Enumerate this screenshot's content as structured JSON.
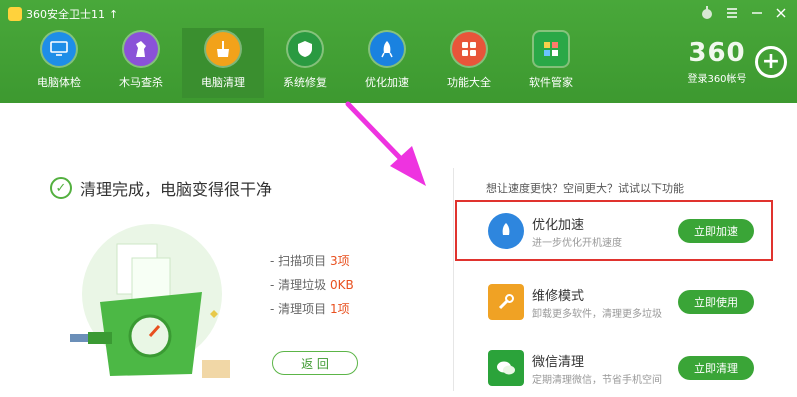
{
  "app_title": "360安全卫士11",
  "app_title_arrow": "↑",
  "window_controls": [
    "skin-icon",
    "menu-icon",
    "minimize-icon",
    "close-icon"
  ],
  "tools": [
    {
      "label": "电脑体检",
      "icon": "monitor-icon",
      "color": "#1e8ee8"
    },
    {
      "label": "木马查杀",
      "icon": "horse-icon",
      "color": "#8a52d8"
    },
    {
      "label": "电脑清理",
      "icon": "broom-icon",
      "color": "#f2a21a",
      "active": true
    },
    {
      "label": "系统修复",
      "icon": "shield-icon",
      "color": "#2a9a41"
    },
    {
      "label": "优化加速",
      "icon": "rocket-icon",
      "color": "#1a82e0"
    },
    {
      "label": "功能大全",
      "icon": "grid-icon",
      "color": "#e8553a"
    },
    {
      "label": "软件管家",
      "icon": "apps-icon",
      "color": "#2aa847"
    }
  ],
  "brand": {
    "logo": "360",
    "login": "登录360帐号"
  },
  "result": {
    "title": "清理完成，电脑变得很干净"
  },
  "stats": [
    {
      "label": "扫描项目",
      "value": "3项"
    },
    {
      "label": "清理垃圾",
      "value": "0KB"
    },
    {
      "label": "清理项目",
      "value": "1项"
    }
  ],
  "back_button": "返  回",
  "suggest_title": "想让速度更快？空间更大？试试以下功能",
  "cards": [
    {
      "name": "优化加速",
      "desc": "进一步优化开机速度",
      "button": "立即加速",
      "icon": "rocket-icon",
      "color": "#2e86de"
    },
    {
      "name": "维修模式",
      "desc": "卸载更多软件，清理更多垃圾",
      "button": "立即使用",
      "icon": "wrench-icon",
      "color": "#f0a224"
    },
    {
      "name": "微信清理",
      "desc": "定期清理微信，节省手机空间",
      "button": "立即清理",
      "icon": "wechat-icon",
      "color": "#2ba33a"
    }
  ],
  "colors": {
    "header_green": "#45a336",
    "accent_red": "#e0332e",
    "arrow_pink": "#ee33e0"
  }
}
